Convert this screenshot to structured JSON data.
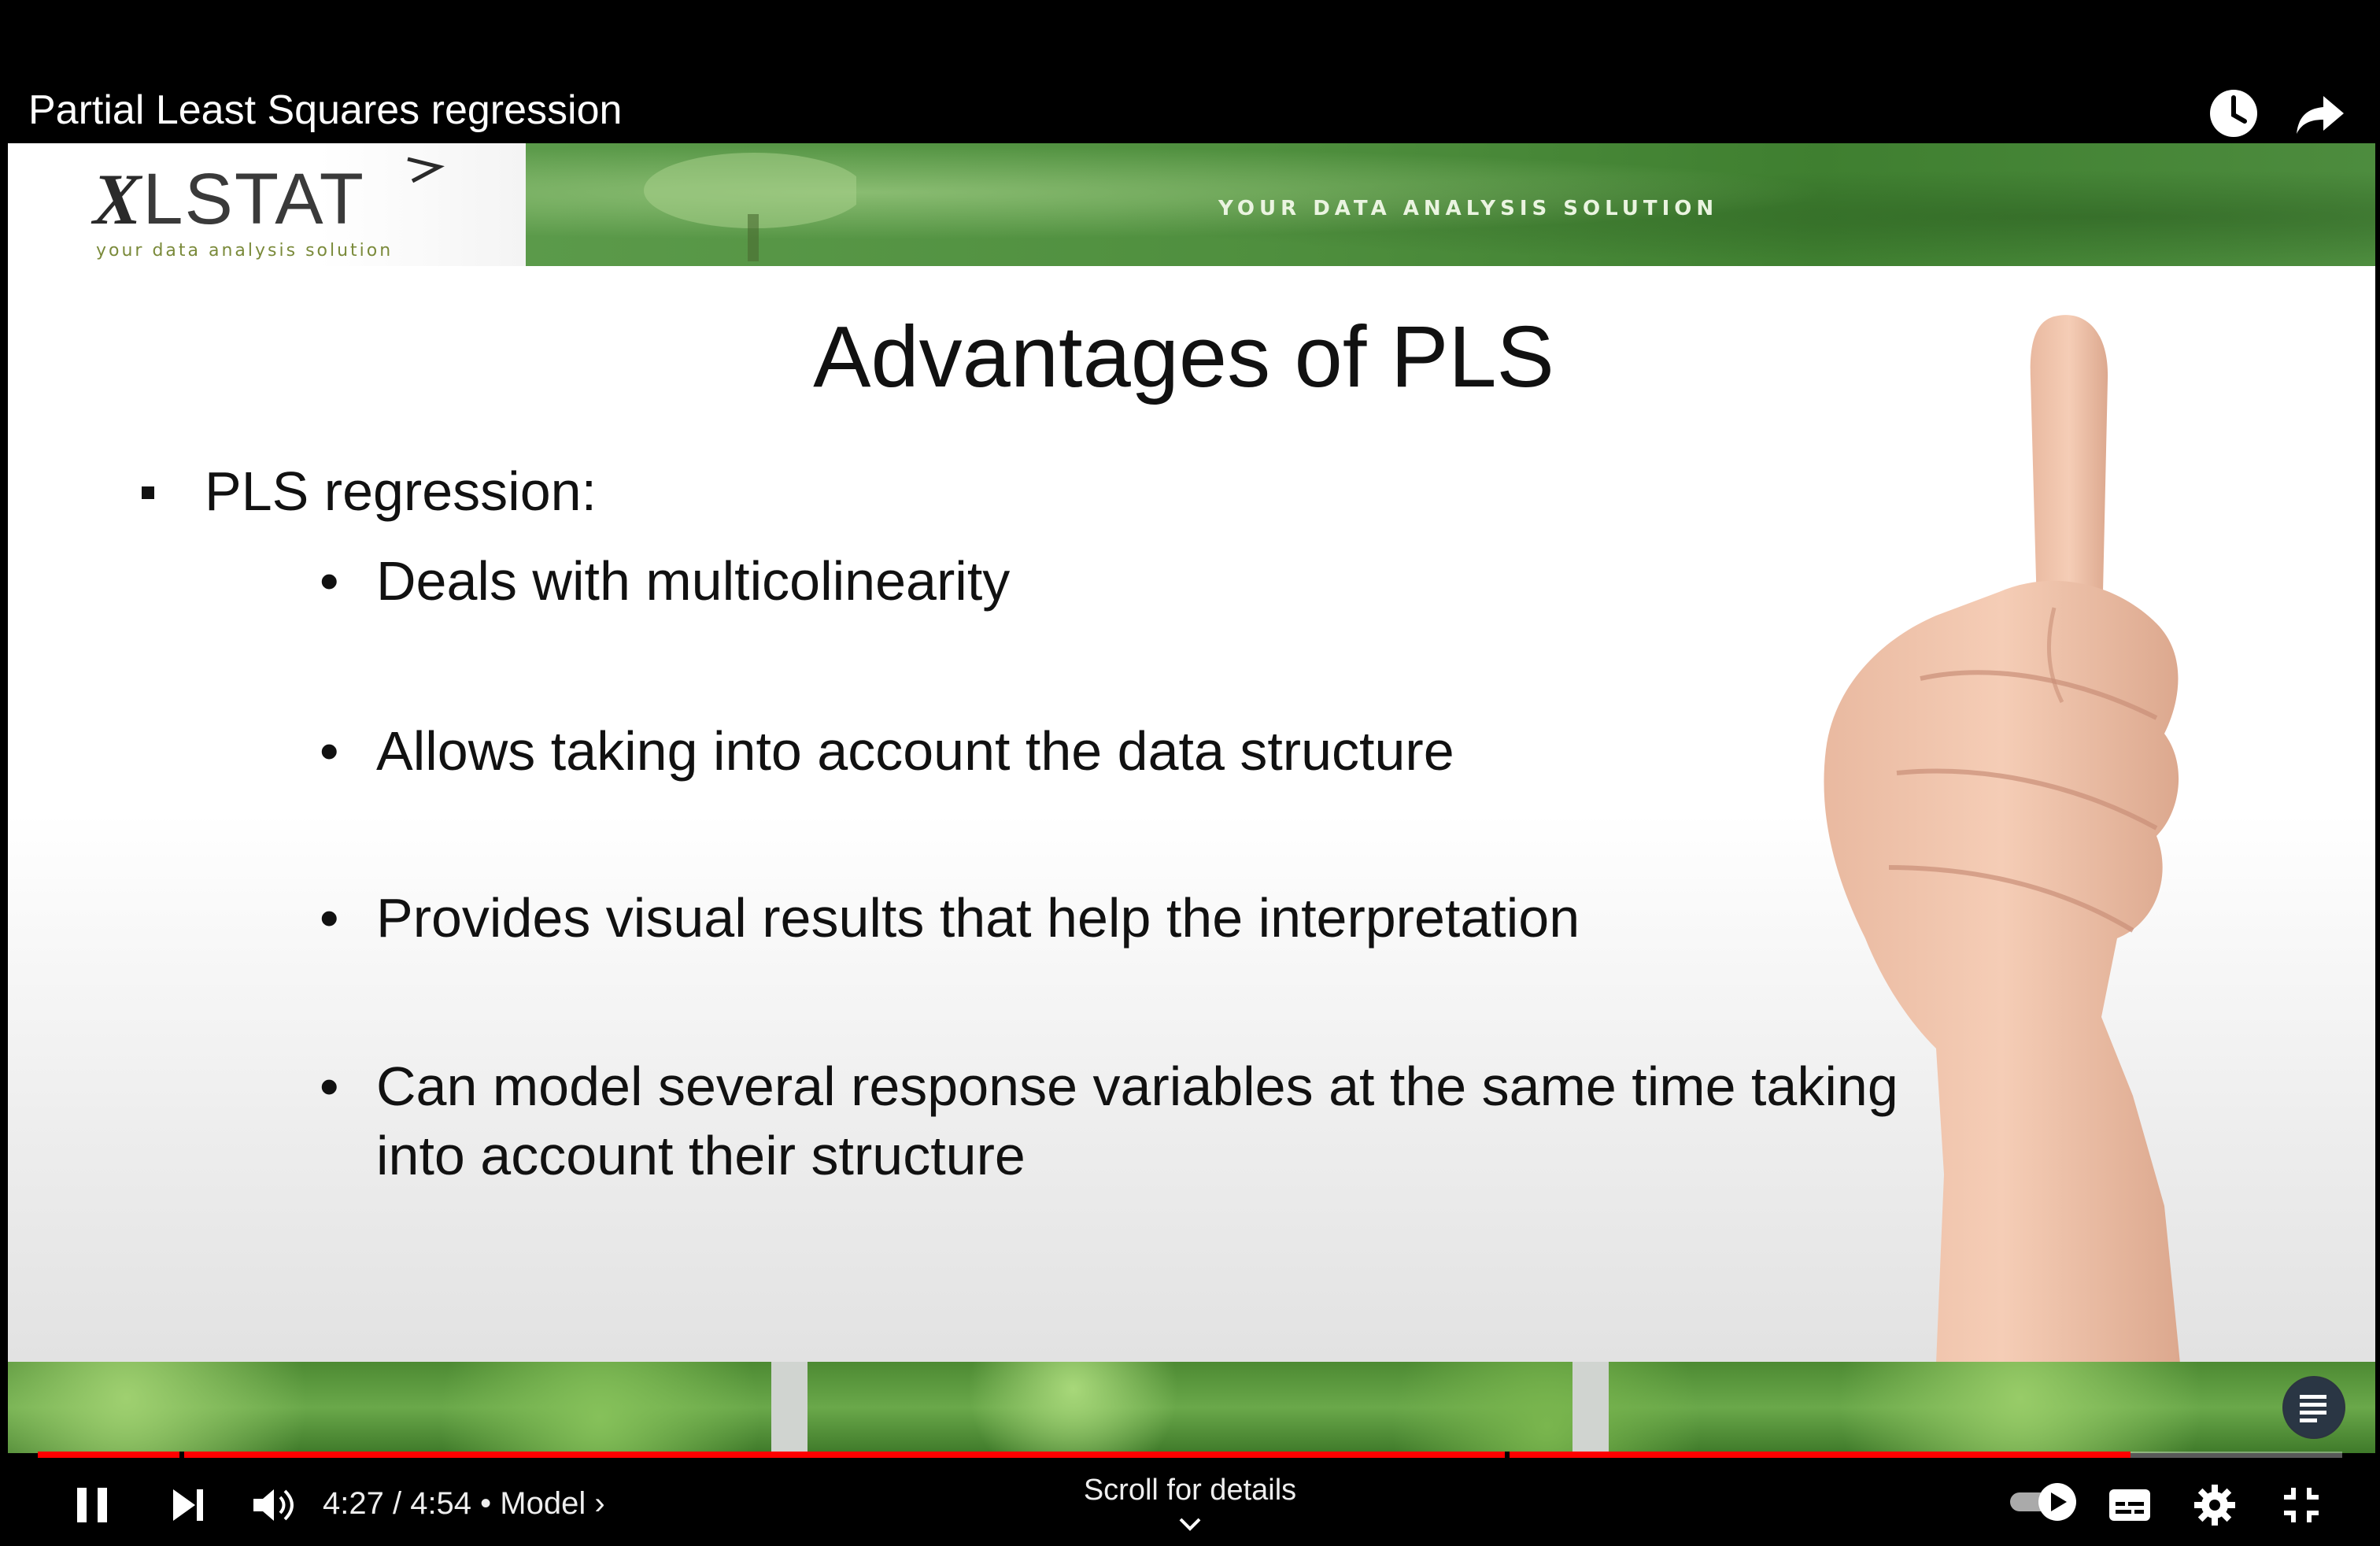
{
  "video": {
    "title": "Partial Least Squares regression"
  },
  "slide": {
    "logo_main_italic": "X",
    "logo_main_rest": "LSTAT",
    "logo_tagline": "your data analysis solution",
    "banner_tagline": "YOUR DATA ANALYSIS SOLUTION",
    "title": "Advantages of PLS",
    "main_bullet": "PLS regression:",
    "sub_bullets": [
      "Deals with multicolinearity",
      "Allows taking into account the data structure",
      "Provides visual results that help the interpretation",
      "Can model several response variables at the same time taking into account their structure"
    ],
    "bullet_glyph": "•"
  },
  "player": {
    "time_display": "4:27 / 4:54 • Model ›",
    "progress_fraction": 0.908,
    "scroll_hint": "Scroll for details",
    "progress_color": "#ff0000",
    "icons": {
      "watch_later": "clock-icon",
      "share": "share-arrow-icon",
      "pause": "pause-icon",
      "next": "next-icon",
      "volume": "volume-icon",
      "autoplay": "autoplay-toggle-icon",
      "captions": "captions-icon",
      "settings": "gear-icon",
      "fullscreen_exit": "exit-fullscreen-icon",
      "chapters": "chapters-list-icon"
    }
  }
}
